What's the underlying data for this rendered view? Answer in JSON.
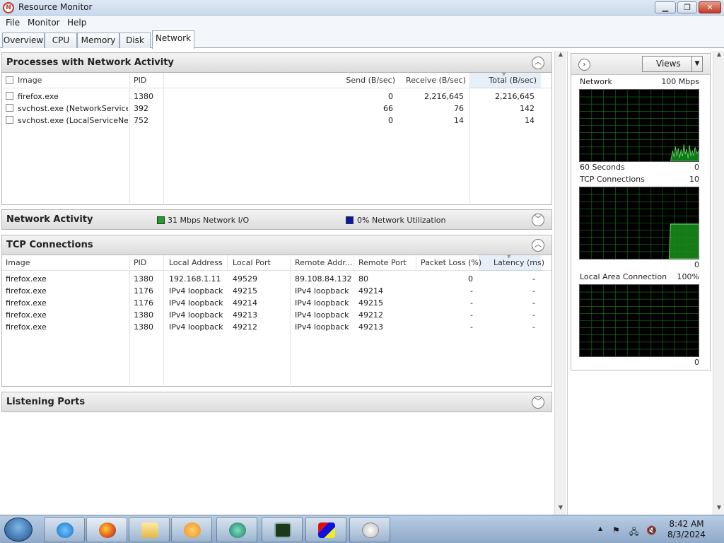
{
  "window": {
    "title": "Resource Monitor",
    "app_icon": "resource-monitor-icon",
    "min": "▁",
    "max": "❐",
    "close": "✕"
  },
  "menu": [
    "File",
    "Monitor",
    "Help"
  ],
  "tabs": [
    "Overview",
    "CPU",
    "Memory",
    "Disk",
    "Network"
  ],
  "active_tab": "Network",
  "processes": {
    "title": "Processes with Network Activity",
    "columns": {
      "image": "Image",
      "pid": "PID",
      "send": "Send (B/sec)",
      "receive": "Receive (B/sec)",
      "total": "Total (B/sec)"
    },
    "rows": [
      {
        "image": "firefox.exe",
        "pid": "1380",
        "send": "0",
        "receive": "2,216,645",
        "total": "2,216,645"
      },
      {
        "image": "svchost.exe (NetworkService)",
        "pid": "392",
        "send": "66",
        "receive": "76",
        "total": "142"
      },
      {
        "image": "svchost.exe (LocalServiceNet...",
        "pid": "752",
        "send": "0",
        "receive": "14",
        "total": "14"
      }
    ]
  },
  "network_activity": {
    "title": "Network Activity",
    "io": "31 Mbps Network I/O",
    "util": "0% Network Utilization",
    "io_color": "#1e9e2a",
    "util_color": "#0a1aa8"
  },
  "tcp": {
    "title": "TCP Connections",
    "columns": {
      "image": "Image",
      "pid": "PID",
      "local_addr": "Local Address",
      "local_port": "Local Port",
      "remote_addr": "Remote Addr...",
      "remote_port": "Remote Port",
      "packet_loss": "Packet Loss (%)",
      "latency": "Latency (ms)"
    },
    "rows": [
      {
        "image": "firefox.exe",
        "pid": "1380",
        "local_addr": "192.168.1.11",
        "local_port": "49529",
        "remote_addr": "89.108.84.132",
        "remote_port": "80",
        "packet_loss": "0",
        "latency": "-"
      },
      {
        "image": "firefox.exe",
        "pid": "1176",
        "local_addr": "IPv4 loopback",
        "local_port": "49215",
        "remote_addr": "IPv4 loopback",
        "remote_port": "49214",
        "packet_loss": "-",
        "latency": "-"
      },
      {
        "image": "firefox.exe",
        "pid": "1176",
        "local_addr": "IPv4 loopback",
        "local_port": "49214",
        "remote_addr": "IPv4 loopback",
        "remote_port": "49215",
        "packet_loss": "-",
        "latency": "-"
      },
      {
        "image": "firefox.exe",
        "pid": "1380",
        "local_addr": "IPv4 loopback",
        "local_port": "49213",
        "remote_addr": "IPv4 loopback",
        "remote_port": "49212",
        "packet_loss": "-",
        "latency": "-"
      },
      {
        "image": "firefox.exe",
        "pid": "1380",
        "local_addr": "IPv4 loopback",
        "local_port": "49212",
        "remote_addr": "IPv4 loopback",
        "remote_port": "49213",
        "packet_loss": "-",
        "latency": "-"
      }
    ]
  },
  "listening": {
    "title": "Listening Ports"
  },
  "graphs": {
    "views": "Views",
    "network": {
      "title": "Network",
      "max": "100 Mbps",
      "time": "60 Seconds",
      "min": "0"
    },
    "tcp": {
      "title": "TCP Connections",
      "max": "10",
      "min": "0"
    },
    "lan": {
      "title": "Local Area Connection",
      "max": "100%",
      "min": "0"
    },
    "grid_color": "#1c7a1c",
    "line_color": "#6be06b"
  },
  "taskbar": {
    "apps": [
      "windows-start",
      "internet-explorer",
      "firefox",
      "windows-explorer",
      "media-player",
      "media-center",
      "resource-monitor",
      "paint",
      "performance-monitor"
    ],
    "clock_time": "8:42 AM",
    "clock_date": "8/3/2024",
    "tray_up": "▲",
    "tray_flag": "⚑",
    "tray_net": "🖧",
    "tray_speaker": "🔇"
  }
}
